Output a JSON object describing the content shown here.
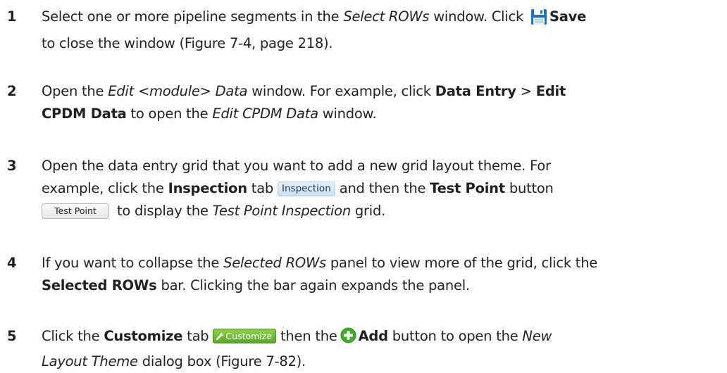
{
  "steps": [
    {
      "number": "1",
      "t1": "Select one or more pipeline segments in the ",
      "t2": "Select ROWs",
      "t3": " window. Click ",
      "t4": "Save",
      "t5": "to close the window (Figure 7-4, page 218)."
    },
    {
      "number": "2",
      "t1": "Open the ",
      "t2": "Edit <module> Data",
      "t3": " window. For example, click ",
      "t4": "Data Entry",
      "t5": " > ",
      "t6": "Edit",
      "t7": "CPDM Data",
      "t8": " to open the ",
      "t9": "Edit CPDM Data",
      "t10": " window."
    },
    {
      "number": "3",
      "t1": "Open the data entry grid that you want to add a new grid layout theme. For",
      "t2": "example, click the ",
      "t3": "Inspection",
      "t4": " tab",
      "t5": "Inspection",
      "t6": "and then the ",
      "t7": "Test Point",
      "t8": " button",
      "t9": "Test Point",
      "t10": "to display the ",
      "t11": "Test Point Inspection",
      "t12": " grid."
    },
    {
      "number": "4",
      "t1": "If you want to collapse the ",
      "t2": "Selected ROWs",
      "t3": " panel to view more of the grid, click the",
      "t4": "Selected ROWs",
      "t5": " bar. Clicking the bar again expands the panel."
    },
    {
      "number": "5",
      "t1": "Click the ",
      "t2": "Customize",
      "t3": " tab",
      "t4": "Customize",
      "t5": "then the",
      "t6": "Add",
      "t7": " button to open the ",
      "t8": "New",
      "t9": "Layout Theme",
      "t10": " dialog box (Figure 7-82)."
    }
  ],
  "icons": {
    "save": "save-icon",
    "wrench": "wrench-icon",
    "add": "plus-circle-icon"
  },
  "colors": {
    "text": "#231f20",
    "save_icon": "#1e73be",
    "inspection_tab": "#c9e1f5",
    "customize_tab": "#6fb733",
    "add_icon": "#3fae2a"
  }
}
